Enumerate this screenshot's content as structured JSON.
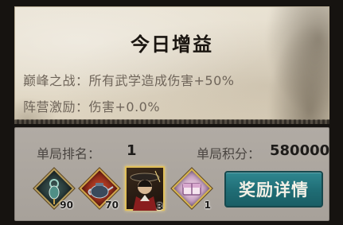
{
  "buff": {
    "title": "今日增益",
    "line1": "巅峰之战：所有武学造成伤害+50%",
    "line2": "阵营激励：伤害+0.0%"
  },
  "stats": {
    "rank_label": "单局排名：",
    "rank_value": "1",
    "score_label": "单局积分：",
    "score_value": "580000"
  },
  "rewards": [
    {
      "icon": "jade-pendant-icon",
      "count": "90"
    },
    {
      "icon": "teapot-icon",
      "count": "70"
    },
    {
      "icon": "swordsman-portrait-icon",
      "count": "3"
    },
    {
      "icon": "gift-chest-icon",
      "count": "1"
    }
  ],
  "reward_button": {
    "label": "奖励详情"
  }
}
